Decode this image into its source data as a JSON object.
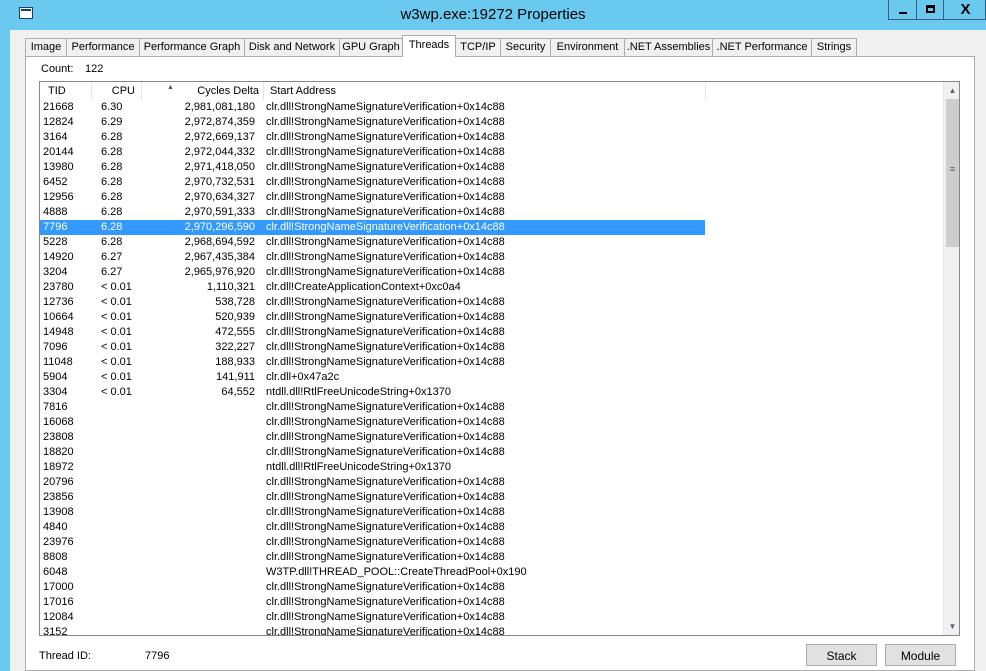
{
  "window": {
    "title": "w3wp.exe:19272 Properties",
    "close_glyph": "X"
  },
  "tabs": [
    {
      "label": "Image"
    },
    {
      "label": "Performance"
    },
    {
      "label": "Performance Graph"
    },
    {
      "label": "Disk and Network"
    },
    {
      "label": "GPU Graph"
    },
    {
      "label": "Threads",
      "active": true
    },
    {
      "label": "TCP/IP"
    },
    {
      "label": "Security"
    },
    {
      "label": "Environment"
    },
    {
      "label": ".NET Assemblies"
    },
    {
      "label": ".NET Performance"
    },
    {
      "label": "Strings"
    }
  ],
  "count": {
    "label": "Count:",
    "value": "122"
  },
  "columns": {
    "tid": "TID",
    "cpu": "CPU",
    "cycles": "Cycles Delta",
    "start": "Start Address"
  },
  "sort_icon": "sort-arrow-up-icon",
  "threads": [
    {
      "tid": "21668",
      "cpu": "6.30",
      "cycles": "2,981,081,180",
      "start": "clr.dll!StrongNameSignatureVerification+0x14c88"
    },
    {
      "tid": "12824",
      "cpu": "6.29",
      "cycles": "2,972,874,359",
      "start": "clr.dll!StrongNameSignatureVerification+0x14c88"
    },
    {
      "tid": "3164",
      "cpu": "6.28",
      "cycles": "2,972,669,137",
      "start": "clr.dll!StrongNameSignatureVerification+0x14c88"
    },
    {
      "tid": "20144",
      "cpu": "6.28",
      "cycles": "2,972,044,332",
      "start": "clr.dll!StrongNameSignatureVerification+0x14c88"
    },
    {
      "tid": "13980",
      "cpu": "6.28",
      "cycles": "2,971,418,050",
      "start": "clr.dll!StrongNameSignatureVerification+0x14c88"
    },
    {
      "tid": "6452",
      "cpu": "6.28",
      "cycles": "2,970,732,531",
      "start": "clr.dll!StrongNameSignatureVerification+0x14c88"
    },
    {
      "tid": "12956",
      "cpu": "6.28",
      "cycles": "2,970,634,327",
      "start": "clr.dll!StrongNameSignatureVerification+0x14c88"
    },
    {
      "tid": "4888",
      "cpu": "6.28",
      "cycles": "2,970,591,333",
      "start": "clr.dll!StrongNameSignatureVerification+0x14c88"
    },
    {
      "tid": "7796",
      "cpu": "6.28",
      "cycles": "2,970,296,590",
      "start": "clr.dll!StrongNameSignatureVerification+0x14c88",
      "selected": true
    },
    {
      "tid": "5228",
      "cpu": "6.28",
      "cycles": "2,968,694,592",
      "start": "clr.dll!StrongNameSignatureVerification+0x14c88"
    },
    {
      "tid": "14920",
      "cpu": "6.27",
      "cycles": "2,967,435,384",
      "start": "clr.dll!StrongNameSignatureVerification+0x14c88"
    },
    {
      "tid": "3204",
      "cpu": "6.27",
      "cycles": "2,965,976,920",
      "start": "clr.dll!StrongNameSignatureVerification+0x14c88"
    },
    {
      "tid": "23780",
      "cpu": "< 0.01",
      "cycles": "1,110,321",
      "start": "clr.dll!CreateApplicationContext+0xc0a4"
    },
    {
      "tid": "12736",
      "cpu": "< 0.01",
      "cycles": "538,728",
      "start": "clr.dll!StrongNameSignatureVerification+0x14c88"
    },
    {
      "tid": "10664",
      "cpu": "< 0.01",
      "cycles": "520,939",
      "start": "clr.dll!StrongNameSignatureVerification+0x14c88"
    },
    {
      "tid": "14948",
      "cpu": "< 0.01",
      "cycles": "472,555",
      "start": "clr.dll!StrongNameSignatureVerification+0x14c88"
    },
    {
      "tid": "7096",
      "cpu": "< 0.01",
      "cycles": "322,227",
      "start": "clr.dll!StrongNameSignatureVerification+0x14c88"
    },
    {
      "tid": "11048",
      "cpu": "< 0.01",
      "cycles": "188,933",
      "start": "clr.dll!StrongNameSignatureVerification+0x14c88"
    },
    {
      "tid": "5904",
      "cpu": "< 0.01",
      "cycles": "141,911",
      "start": "clr.dll+0x47a2c"
    },
    {
      "tid": "3304",
      "cpu": "< 0.01",
      "cycles": "64,552",
      "start": "ntdll.dll!RtlFreeUnicodeString+0x1370"
    },
    {
      "tid": "7816",
      "cpu": "",
      "cycles": "",
      "start": "clr.dll!StrongNameSignatureVerification+0x14c88"
    },
    {
      "tid": "16068",
      "cpu": "",
      "cycles": "",
      "start": "clr.dll!StrongNameSignatureVerification+0x14c88"
    },
    {
      "tid": "23808",
      "cpu": "",
      "cycles": "",
      "start": "clr.dll!StrongNameSignatureVerification+0x14c88"
    },
    {
      "tid": "18820",
      "cpu": "",
      "cycles": "",
      "start": "clr.dll!StrongNameSignatureVerification+0x14c88"
    },
    {
      "tid": "18972",
      "cpu": "",
      "cycles": "",
      "start": "ntdll.dll!RtlFreeUnicodeString+0x1370"
    },
    {
      "tid": "20796",
      "cpu": "",
      "cycles": "",
      "start": "clr.dll!StrongNameSignatureVerification+0x14c88"
    },
    {
      "tid": "23856",
      "cpu": "",
      "cycles": "",
      "start": "clr.dll!StrongNameSignatureVerification+0x14c88"
    },
    {
      "tid": "13908",
      "cpu": "",
      "cycles": "",
      "start": "clr.dll!StrongNameSignatureVerification+0x14c88"
    },
    {
      "tid": "4840",
      "cpu": "",
      "cycles": "",
      "start": "clr.dll!StrongNameSignatureVerification+0x14c88"
    },
    {
      "tid": "23976",
      "cpu": "",
      "cycles": "",
      "start": "clr.dll!StrongNameSignatureVerification+0x14c88"
    },
    {
      "tid": "8808",
      "cpu": "",
      "cycles": "",
      "start": "clr.dll!StrongNameSignatureVerification+0x14c88"
    },
    {
      "tid": "6048",
      "cpu": "",
      "cycles": "",
      "start": "W3TP.dll!THREAD_POOL::CreateThreadPool+0x190"
    },
    {
      "tid": "17000",
      "cpu": "",
      "cycles": "",
      "start": "clr.dll!StrongNameSignatureVerification+0x14c88"
    },
    {
      "tid": "17016",
      "cpu": "",
      "cycles": "",
      "start": "clr.dll!StrongNameSignatureVerification+0x14c88"
    },
    {
      "tid": "12084",
      "cpu": "",
      "cycles": "",
      "start": "clr.dll!StrongNameSignatureVerification+0x14c88"
    },
    {
      "tid": "3152",
      "cpu": "",
      "cycles": "",
      "start": "clr.dll!StrongNameSignatureVerification+0x14c88"
    }
  ],
  "detail": {
    "thread_id_label": "Thread ID:",
    "thread_id_value": "7796"
  },
  "buttons": {
    "stack": "Stack",
    "module": "Module"
  },
  "scrollbar": {
    "up_glyph": "▲",
    "down_glyph": "▼",
    "grip_glyph": "≡"
  }
}
